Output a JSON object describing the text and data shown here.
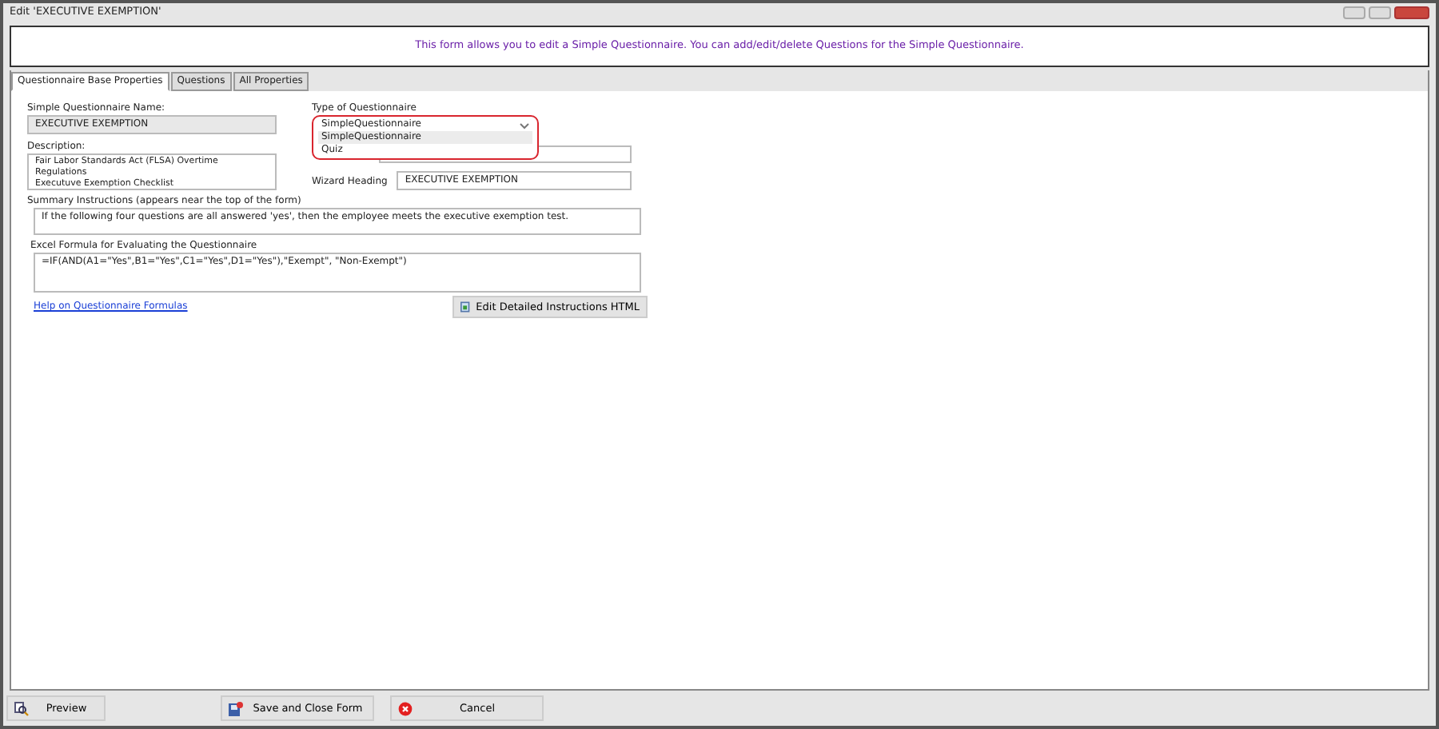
{
  "window": {
    "title": "Edit 'EXECUTIVE EXEMPTION'"
  },
  "banner": "This form allows you to edit a Simple Questionnaire. You can add/edit/delete Questions for the Simple Questionnaire.",
  "tabs": [
    {
      "label": "Questionnaire Base Properties",
      "selected": true
    },
    {
      "label": "Questions",
      "selected": false
    },
    {
      "label": "All Properties",
      "selected": false
    }
  ],
  "name_field": {
    "label": "Simple Questionnaire Name:",
    "value": "EXECUTIVE EXEMPTION"
  },
  "description": {
    "label": "Description:",
    "value": "Fair Labor Standards Act (FLSA) Overtime Regulations\nExecutuve Exemption Checklist"
  },
  "type_dropdown": {
    "label": "Type of Questionnaire",
    "value": "SimpleQuestionnaire",
    "expanded": true,
    "options": [
      {
        "label": "SimpleQuestionnaire",
        "selected": true
      },
      {
        "label": "Quiz",
        "selected": false
      }
    ]
  },
  "wizard_heading": {
    "label": "Wizard Heading",
    "value": "EXECUTIVE EXEMPTION"
  },
  "summary": {
    "label": "Summary Instructions (appears near the top of the form)",
    "value": "If the following four questions are all answered 'yes', then the employee meets the executive exemption test."
  },
  "formula": {
    "label": "Excel Formula for Evaluating the Questionnaire",
    "value": "=IF(AND(A1=\"Yes\",B1=\"Yes\",C1=\"Yes\",D1=\"Yes\"),\"Exempt\", \"Non-Exempt\")"
  },
  "help_link": "Help on Questionnaire Formulas",
  "edit_html_button": "Edit Detailed Instructions HTML",
  "footer_buttons": [
    {
      "kind": "preview",
      "label": "Preview"
    },
    {
      "kind": "save",
      "label": "Save and Close Form"
    },
    {
      "kind": "cancel",
      "label": "Cancel"
    }
  ]
}
